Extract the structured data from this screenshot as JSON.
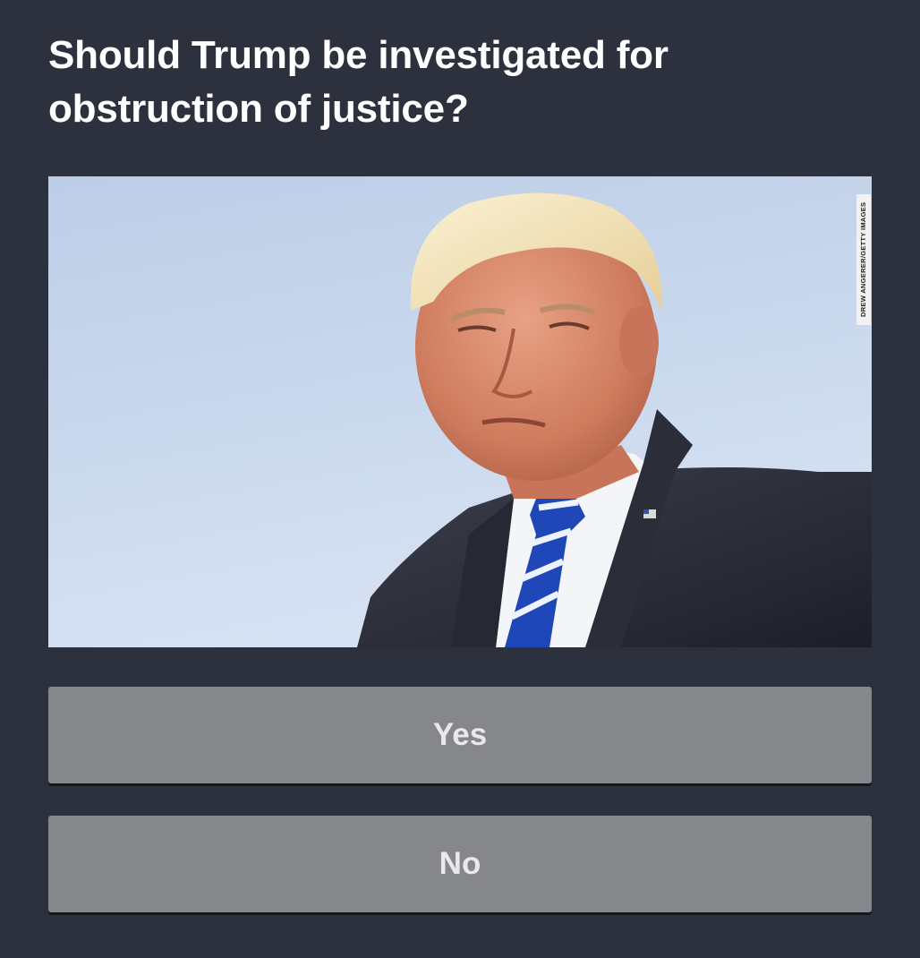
{
  "poll": {
    "question": "Should Trump be investigated for obstruction of justice?",
    "photo_credit": "DREW ANGERER/GETTY IMAGES",
    "answers": [
      {
        "label": "Yes"
      },
      {
        "label": "No"
      }
    ]
  },
  "colors": {
    "background": "#2d313d",
    "button": "#86878b",
    "button_text": "#e9e9ec",
    "question_text": "#ffffff",
    "sky": "#c9d8ee"
  }
}
